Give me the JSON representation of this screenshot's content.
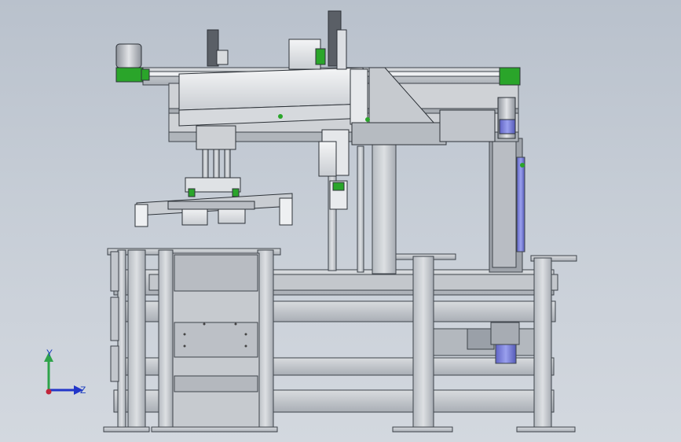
{
  "view": {
    "background_top": "#b9c1cc",
    "background_bottom": "#d3d8df",
    "part_fill": "#c8ccd1",
    "part_dark": "#8e949c",
    "part_light": "#e6e9ed",
    "accent_green": "#2aa52a",
    "accent_purple": "#7a55b5",
    "accent_blue": "#6f7ad8"
  },
  "triad": {
    "y_label": "Y",
    "z_label": "Z",
    "y_color": "#2fa34a",
    "z_color": "#2236c9",
    "origin_color": "#c0263a"
  }
}
